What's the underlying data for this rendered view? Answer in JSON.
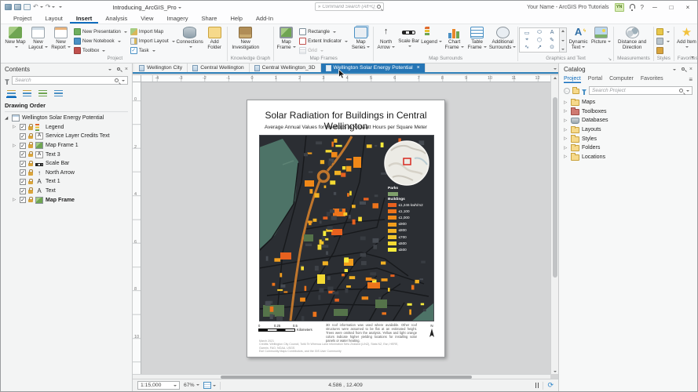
{
  "titlebar": {
    "title": "Introducing_ArcGIS_Pro",
    "search_placeholder": "Command Search (Alt+Q)",
    "account_name": "Your Name - ArcGIS Pro Tutorials",
    "account_badge": "YN",
    "help_label": "?",
    "minimize": "─",
    "maximize": "□",
    "close": "×"
  },
  "ribbon": {
    "tabs": [
      "Project",
      "Layout",
      "Insert",
      "Analysis",
      "View",
      "Imagery",
      "Share",
      "Help",
      "Add-In"
    ],
    "active_tab": "Insert",
    "project": {
      "label": "Project",
      "new_map": "New Map",
      "new_layout": "New Layout",
      "new_report": "New Report",
      "new_presentation": "New Presentation",
      "new_notebook": "New Notebook",
      "toolbox": "Toolbox",
      "import_map": "Import Map",
      "import_layout": "Import Layout",
      "task": "Task",
      "connections": "Connections",
      "add_folder": "Add Folder"
    },
    "knowledge_graph": {
      "label": "Knowledge Graph",
      "new_investigation": "New Investigation"
    },
    "map_frames": {
      "label": "Map Frames",
      "map_frame": "Map Frame",
      "rectangle": "Rectangle",
      "extent_indicator": "Extent Indicator",
      "grid": "Grid",
      "map_series": "Map Series"
    },
    "map_surrounds": {
      "label": "Map Surrounds",
      "north_arrow": "North Arrow",
      "scale_bar": "Scale Bar",
      "legend": "Legend",
      "chart_frame": "Chart Frame",
      "table_frame": "Table Frame",
      "additional_surrounds": "Additional Surrounds"
    },
    "graphics_text": {
      "label": "Graphics and Text",
      "dynamic_text": "Dynamic Text",
      "picture": "Picture",
      "gallery_glyphs": [
        "▭",
        "⬭",
        "A",
        "⌖",
        "⬡",
        "✎",
        "∿",
        "↗",
        "⊙"
      ]
    },
    "measurements": {
      "label": "Measurements",
      "distance_direction": "Distance and Direction"
    },
    "styles": {
      "label": "Styles"
    },
    "favorites": {
      "label": "Favorites",
      "add_item": "Add Item"
    }
  },
  "contents": {
    "title": "Contents",
    "search_placeholder": "Search",
    "heading": "Drawing Order",
    "root": "Wellington Solar Energy Potential",
    "items": [
      {
        "label": "Legend"
      },
      {
        "label": "Service Layer Credits Text"
      },
      {
        "label": "Map Frame 1"
      },
      {
        "label": "Text 3"
      },
      {
        "label": "Scale Bar"
      },
      {
        "label": "North Arrow"
      },
      {
        "label": "Text 1"
      },
      {
        "label": "Text"
      },
      {
        "label": "Map Frame"
      }
    ]
  },
  "view": {
    "tabs": [
      "Wellington City",
      "Central Wellington",
      "Central Wellington_3D",
      "Wellington Solar Energy Potential"
    ],
    "active_tab": "Wellington Solar Energy Potential",
    "ruler_h": [
      -4,
      -3,
      -2,
      -1,
      0,
      1,
      2,
      3,
      4,
      5,
      6,
      7,
      8,
      9,
      10,
      11,
      12
    ],
    "ruler_v": [
      0,
      2,
      4,
      6,
      8,
      10
    ]
  },
  "page": {
    "title": "Solar Radiation for Buildings in Central Wellington",
    "subtitle": "Average Annual Values for Rooftops in Kilowatt Hours per Square Meter",
    "legend": {
      "parks_label": "Parks",
      "parks_color": "#7fa06b",
      "buildings_label": "Buildings",
      "items": [
        {
          "label": "≤1,246 kwh/m2",
          "color": "#e8611f"
        },
        {
          "label": "≤1,100",
          "color": "#ed741b"
        },
        {
          "label": "≤1,000",
          "color": "#f08818"
        },
        {
          "label": "≤900",
          "color": "#f29d1d"
        },
        {
          "label": "≤800",
          "color": "#f1b123"
        },
        {
          "label": "≤700",
          "color": "#f2c62b"
        },
        {
          "label": "≤600",
          "color": "#f4da33"
        },
        {
          "label": "≤500",
          "color": "#f7ec3c"
        }
      ]
    },
    "scale_bar": {
      "labels": [
        "0",
        "0.25",
        "0.5"
      ],
      "unit": "Kilometers"
    },
    "notes": "3D roof information was used where available. Other roof structures were assumed to be flat at an estimated height. Trees were omitted from the analysis. Yellow and light orange colors indicate higher yielding locations for installing solar panels or water heating.",
    "credits": [
      "March 2021",
      "Credits: Wellington City Council, Toitū Te Whenua Land Information New Zealand (LINZ), Stats NZ, Esri, HERE, Garmin, FAO, NOAA, USGS",
      "Esri Community Maps Contributors, and the GIS User Community"
    ],
    "north_label": "N"
  },
  "statusbar": {
    "scale": "1:15,000",
    "zoom": "67%",
    "coords": "4.586 , 12.409"
  },
  "catalog": {
    "title": "Catalog",
    "tabs": [
      "Project",
      "Portal",
      "Computer",
      "Favorites"
    ],
    "active_tab": "Project",
    "search_placeholder": "Search Project",
    "items": [
      {
        "label": "Maps"
      },
      {
        "label": "Toolboxes"
      },
      {
        "label": "Databases"
      },
      {
        "label": "Layouts"
      },
      {
        "label": "Styles"
      },
      {
        "label": "Folders"
      },
      {
        "label": "Locations"
      }
    ]
  },
  "colors": {
    "accent": "#0f6cbd",
    "active_view_tab": "#2575b5",
    "map_background": "#2b2e33",
    "water": "#4d7367"
  }
}
